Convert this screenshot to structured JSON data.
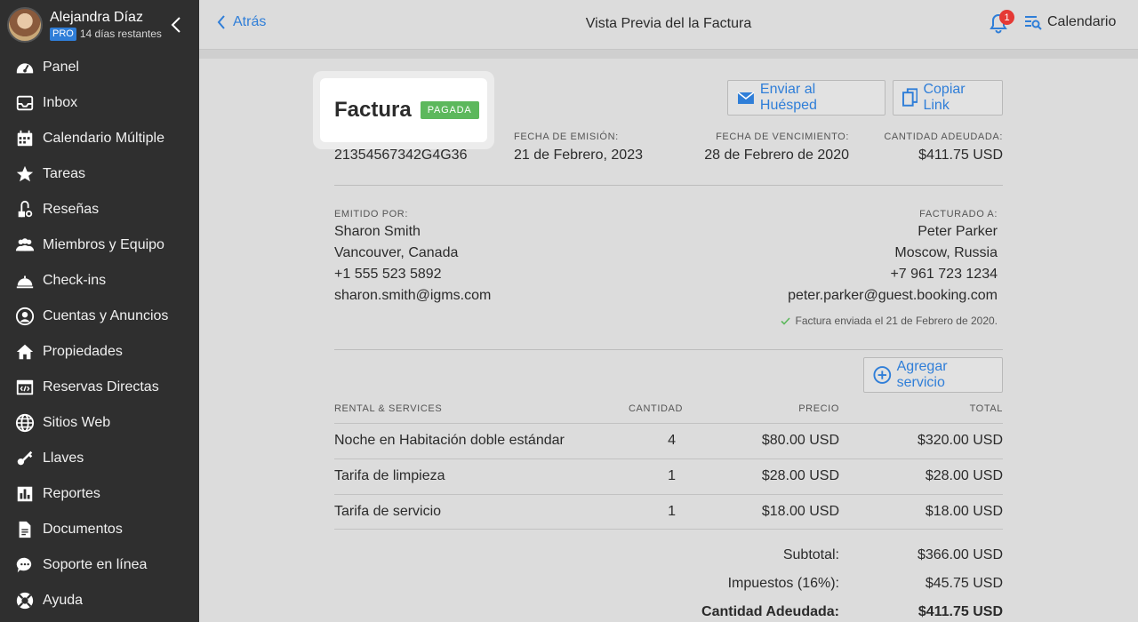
{
  "user": {
    "name": "Alejandra Díaz",
    "plan": "PRO",
    "trial": "14 días restantes"
  },
  "sidebar": {
    "items": [
      {
        "label": "Panel",
        "icon": "dashboard-icon"
      },
      {
        "label": "Inbox",
        "icon": "inbox-icon"
      },
      {
        "label": "Calendario Múltiple",
        "icon": "calendar-icon"
      },
      {
        "label": "Tareas",
        "icon": "star-icon"
      },
      {
        "label": "Reseñas",
        "icon": "review-icon"
      },
      {
        "label": "Miembros y Equipo",
        "icon": "team-icon"
      },
      {
        "label": "Check-ins",
        "icon": "bell-service-icon"
      },
      {
        "label": "Cuentas y Anuncios",
        "icon": "account-icon"
      },
      {
        "label": "Propiedades",
        "icon": "home-icon"
      },
      {
        "label": "Reservas Directas",
        "icon": "code-window-icon"
      },
      {
        "label": "Sitios Web",
        "icon": "globe-icon"
      },
      {
        "label": "Llaves",
        "icon": "key-icon"
      },
      {
        "label": "Reportes",
        "icon": "chart-icon"
      },
      {
        "label": "Documentos",
        "icon": "document-icon"
      },
      {
        "label": "Soporte en línea",
        "icon": "chat-icon"
      },
      {
        "label": "Ayuda",
        "icon": "lifebuoy-icon"
      }
    ]
  },
  "header": {
    "back": "Atrás",
    "title": "Vista Previa del la Factura",
    "notifications": "1",
    "calendar": "Calendario"
  },
  "invoice": {
    "title": "Factura",
    "status": "PAGADA",
    "send_button": "Enviar al Huésped",
    "copy_button": "Copiar Link",
    "number": "21354567342G4G36",
    "issue_label": "FECHA DE EMISIÓN:",
    "issue_date": "21 de Febrero, 2023",
    "due_label": "FECHA DE VENCIMIENTO:",
    "due_date": "28 de Febrero de 2020",
    "amount_label": "CANTIDAD ADEUDADA:",
    "amount_due": "$411.75 USD",
    "issuer_label": "EMITIDO POR:",
    "issuer": {
      "name": "Sharon Smith",
      "location": "Vancouver, Canada",
      "phone": "+1 555 523 5892",
      "email": "sharon.smith@igms.com"
    },
    "billed_label": "FACTURADO A:",
    "billed": {
      "name": "Peter Parker",
      "location": "Moscow, Russia",
      "phone": "+7 961 723 1234",
      "email": "peter.parker@guest.booking.com"
    },
    "sent_note": "Factura enviada el 21 de Febrero de 2020.",
    "add_service": "Agregar servicio",
    "columns": [
      "RENTAL & SERVICES",
      "CANTIDAD",
      "PRECIO",
      "TOTAL"
    ],
    "rows": [
      {
        "name": "Noche en Habitación doble estándar",
        "qty": "4",
        "price": "$80.00 USD",
        "total": "$320.00 USD"
      },
      {
        "name": "Tarifa de limpieza",
        "qty": "1",
        "price": "$28.00 USD",
        "total": "$28.00 USD"
      },
      {
        "name": "Tarifa de servicio",
        "qty": "1",
        "price": "$18.00 USD",
        "total": "$18.00 USD"
      }
    ],
    "subtotal_label": "Subtotal:",
    "subtotal": "$366.00 USD",
    "tax_label": "Impuestos (16%):",
    "tax": "$45.75 USD",
    "total_label": "Cantidad Adeudada:",
    "total": "$411.75 USD"
  },
  "colors": {
    "accent": "#2f7ed8",
    "paid": "#5cb85c",
    "sidebar": "#2f2f2f",
    "badge": "#e53935"
  }
}
